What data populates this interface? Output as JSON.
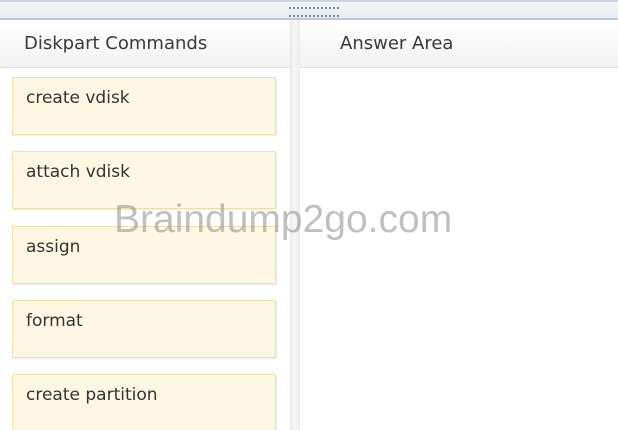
{
  "left_panel": {
    "title": "Diskpart Commands",
    "items": [
      {
        "label": "create vdisk"
      },
      {
        "label": "attach vdisk"
      },
      {
        "label": "assign"
      },
      {
        "label": "format"
      },
      {
        "label": "create partition"
      }
    ]
  },
  "right_panel": {
    "title": "Answer Area"
  },
  "watermark": "Braindump2go.com",
  "colors": {
    "item_background": "#fdf7e3",
    "item_border": "#f0dfa3",
    "header_text": "#3a3a3a"
  }
}
